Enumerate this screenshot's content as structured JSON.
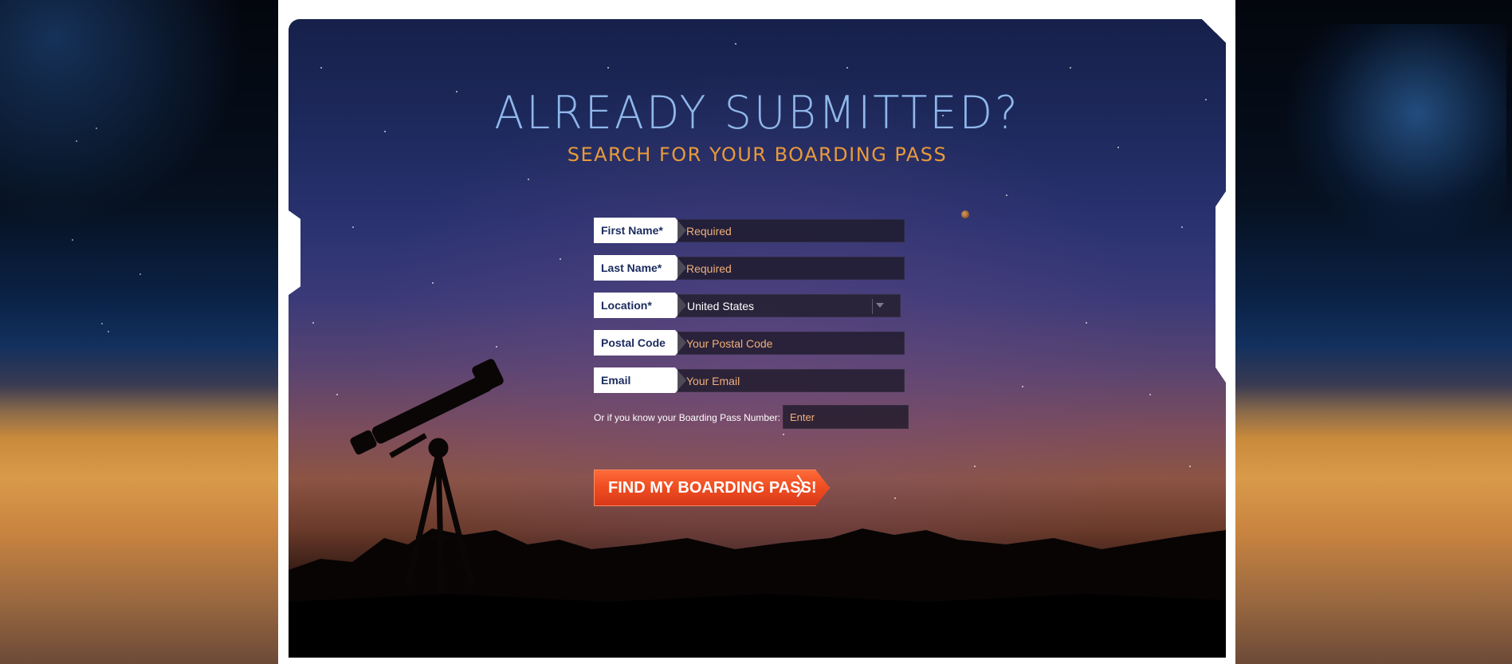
{
  "hero": {
    "title": "ALREADY SUBMITTED?",
    "subtitle": "SEARCH FOR YOUR BOARDING PASS"
  },
  "form": {
    "first_name": {
      "label": "First Name*",
      "placeholder": "Required"
    },
    "last_name": {
      "label": "Last Name*",
      "placeholder": "Required"
    },
    "location": {
      "label": "Location*",
      "selected": "United States"
    },
    "postal_code": {
      "label": "Postal Code",
      "placeholder": "Your Postal Code"
    },
    "email": {
      "label": "Email",
      "placeholder": "Your Email"
    },
    "boarding_pass": {
      "label": "Or if you know your Boarding Pass Number:",
      "placeholder": "Enter"
    },
    "submit_label": "FIND MY BOARDING PASS!",
    "submit_arrow": "〉"
  },
  "colors": {
    "title": "#8fb7ea",
    "subtitle": "#e99a3a",
    "button": "#f04f22",
    "placeholder": "#f0b07a"
  },
  "icons": {
    "dropdown": "chevron-down-icon",
    "telescope": "telescope-icon"
  }
}
